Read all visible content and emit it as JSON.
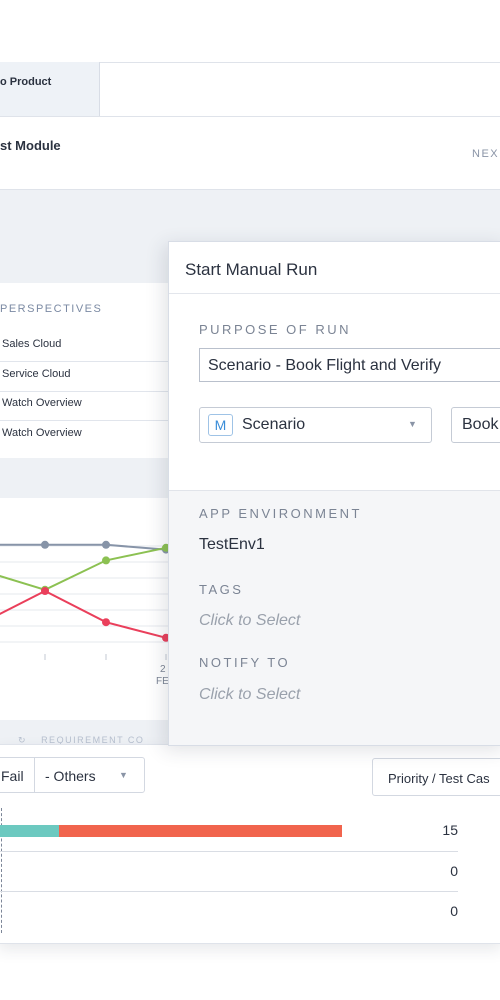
{
  "header": {
    "product_tab": "o Product",
    "module_title": "st Module",
    "next_label": "NEX"
  },
  "perspectives": {
    "heading": "PERSPECTIVES",
    "items": [
      "Sales Cloud",
      "Service Cloud",
      "Watch Overview",
      "Watch Overview"
    ]
  },
  "chart_footer": {
    "refresh_icon": "refresh-icon",
    "label": "REQUIREMENT CO"
  },
  "chart_data": {
    "type": "line",
    "x_tick_labels": [
      "2",
      "FE"
    ],
    "series": [
      {
        "color": "#8794a8",
        "values": [
          0.82,
          0.82,
          0.82,
          0.74
        ]
      },
      {
        "color": "#8cc152",
        "values": [
          0.4,
          0.07,
          0.56,
          0.77
        ]
      },
      {
        "color": "#ea3f5b",
        "values": [
          -0.5,
          0.05,
          -0.47,
          -0.73
        ]
      }
    ]
  },
  "modal": {
    "title": "Start Manual Run",
    "purpose_label": "PURPOSE OF RUN",
    "purpose_value": "Scenario - Book Flight and Verify",
    "type_badge": "M",
    "type_value": "Scenario",
    "book_value": "Book",
    "app_env_label": "APP ENVIRONMENT",
    "app_env_value": "TestEnv1",
    "tags_label": "TAGS",
    "tags_placeholder": "Click to Select",
    "notify_label": "NOTIFY TO",
    "notify_placeholder": "Click to Select"
  },
  "results": {
    "fail_label": "Fail",
    "others_label": "-  Others",
    "priority_label": "Priority / Test Cas",
    "rows": [
      {
        "value": "15",
        "pass_fraction": 0.04,
        "fail_fraction": 0.19
      },
      {
        "value": "0"
      },
      {
        "value": "0"
      }
    ],
    "colors": {
      "pass": "#6cc9c0",
      "fail": "#f1644d"
    }
  }
}
